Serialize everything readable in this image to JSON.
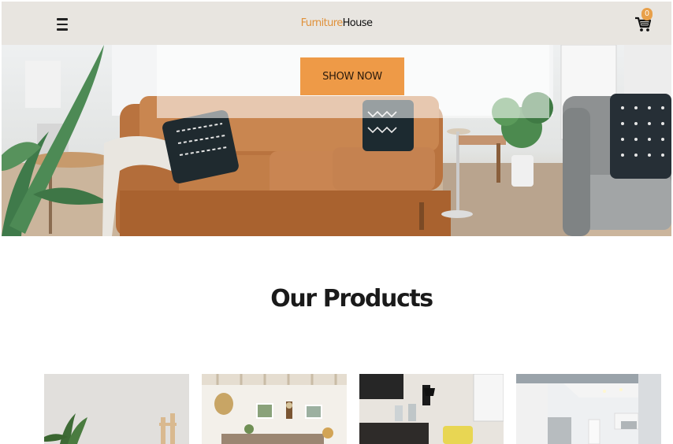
{
  "header": {
    "brand_part1": "Furniture",
    "brand_part2": "House",
    "cart_count": "0"
  },
  "hero": {
    "cta_label": "SHOW NOW"
  },
  "products_section": {
    "title": "Our Products"
  },
  "colors": {
    "accent": "#ee9a47",
    "header_bg": "#e8e5e0"
  }
}
